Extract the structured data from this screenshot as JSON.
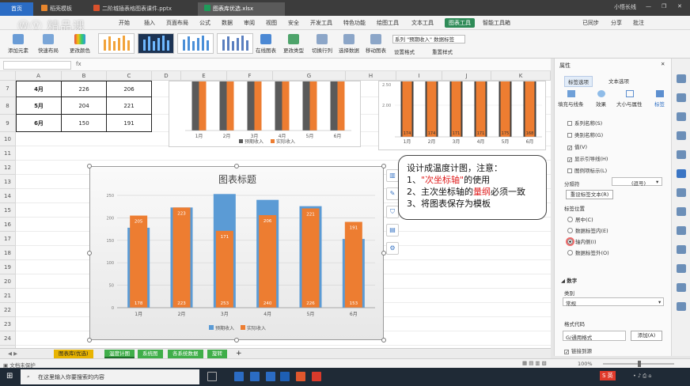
{
  "titlebar": {
    "home_tab": "首页",
    "tabs": [
      {
        "label": "稻壳模板",
        "color": "#e8862d"
      },
      {
        "label": "二阶城插表格图表课件.pptx",
        "color": "#d9512c"
      },
      {
        "label": "图表库优选.xlsx",
        "color": "#1e9b5a"
      }
    ],
    "user": "小悟长线",
    "win_controls": [
      "—",
      "❐",
      "✕"
    ]
  },
  "watermark": "ⓌⓋ 精品课",
  "menus": [
    "开始",
    "插入",
    "页面布局",
    "公式",
    "数据",
    "审阅",
    "视图",
    "安全",
    "开发工具",
    "特色功能",
    "绘图工具",
    "文本工具",
    "图表工具",
    "智能工具箱"
  ],
  "active_menu": "图表工具",
  "menu_right": [
    "已同步",
    "分享",
    "批注"
  ],
  "ribbon": {
    "left_buttons": [
      "添加元素",
      "快速布局",
      "更改颜色"
    ],
    "mid_buttons": [
      "在线图表",
      "更改类型",
      "切换行列",
      "选择数据",
      "移动图表"
    ],
    "series_dropdown": "系列 \"预期收入\" 数据标签",
    "format_buttons": [
      "设置格式",
      "重置样式"
    ]
  },
  "formula": {
    "fx": "fx"
  },
  "sheet": {
    "columns": [
      "A",
      "B",
      "C",
      "D",
      "E",
      "F",
      "G",
      "H",
      "I",
      "J",
      "K"
    ],
    "rows": [
      {
        "num": "7",
        "cells": [
          "4月",
          "226",
          "206"
        ]
      },
      {
        "num": "8",
        "cells": [
          "5月",
          "204",
          "221"
        ]
      },
      {
        "num": "9",
        "cells": [
          "6月",
          "150",
          "191"
        ]
      },
      {
        "num": "10",
        "cells": []
      },
      {
        "num": "11",
        "cells": []
      },
      {
        "num": "12",
        "cells": []
      },
      {
        "num": "13",
        "cells": []
      },
      {
        "num": "14",
        "cells": []
      },
      {
        "num": "15",
        "cells": []
      },
      {
        "num": "16",
        "cells": []
      },
      {
        "num": "17",
        "cells": []
      },
      {
        "num": "18",
        "cells": []
      },
      {
        "num": "19",
        "cells": []
      },
      {
        "num": "20",
        "cells": []
      },
      {
        "num": "21",
        "cells": []
      },
      {
        "num": "22",
        "cells": []
      },
      {
        "num": "23",
        "cells": []
      },
      {
        "num": "24",
        "cells": []
      },
      {
        "num": "25",
        "cells": []
      },
      {
        "num": "26",
        "cells": []
      }
    ]
  },
  "chart_data": [
    {
      "type": "bar",
      "title": "",
      "categories": [
        "1月",
        "2月",
        "3月",
        "4月",
        "5月",
        "6月"
      ],
      "series": [
        {
          "name": "预期收入",
          "color": "#5a5a5a"
        },
        {
          "name": "实际收入",
          "color": "#ed7d31"
        }
      ],
      "legend": "bottom"
    },
    {
      "type": "bar",
      "title": "",
      "categories": [
        "1月",
        "2月",
        "3月",
        "4月",
        "5月",
        "6月"
      ],
      "series": [
        {
          "name": "",
          "values": [
            174,
            174,
            171,
            171,
            175,
            168
          ],
          "color": "#ed7d31"
        }
      ],
      "ylim_labels": [
        "2.50",
        "2.00"
      ]
    },
    {
      "type": "bar",
      "title": "图表标题",
      "categories": [
        "1月",
        "2月",
        "3月",
        "4月",
        "5月",
        "6月"
      ],
      "ylim": [
        0,
        250
      ],
      "yticks": [
        0,
        50,
        100,
        150,
        200,
        250
      ],
      "series": [
        {
          "name": "预期收入",
          "values": [
            178,
            223,
            253,
            240,
            226,
            153
          ],
          "labels": [
            "178",
            "223",
            "253",
            "240",
            "226",
            "153"
          ],
          "color": "#5b9bd5"
        },
        {
          "name": "实际收入",
          "values": [
            205,
            223,
            171,
            206,
            221,
            191
          ],
          "labels": [
            "205",
            "223",
            "171",
            "206",
            "221",
            "191"
          ],
          "color": "#ed7d31"
        }
      ],
      "legend": "bottom"
    }
  ],
  "callout": {
    "line1": "设计成温度计图，注意：",
    "line2_pre": "1、",
    "line2_red": "\"次坐标轴\"",
    "line2_post": "的使用",
    "line3_pre": "2、主次坐标轴的",
    "line3_red": "量纲",
    "line3_post": "必须一致",
    "line4": "3、将图表保存为模板"
  },
  "panel": {
    "title": "属性",
    "tabs": [
      "标签选项",
      "文本选项"
    ],
    "icon_tabs": [
      "填充与线条",
      "效果",
      "大小与属性",
      "标签"
    ],
    "checks": [
      {
        "label": "系列名称(S)",
        "checked": false
      },
      {
        "label": "类别名称(G)",
        "checked": false
      },
      {
        "label": "值(V)",
        "checked": true
      },
      {
        "label": "显示引导线(H)",
        "checked": true
      },
      {
        "label": "图例项标示(L)",
        "checked": false
      }
    ],
    "separator_label": "分隔符",
    "separator_value": "(逗号)",
    "reset_button": "重设标签文本(R)",
    "position_label": "标签位置",
    "positions": [
      {
        "label": "居中(C)",
        "selected": false
      },
      {
        "label": "数据标签内(E)",
        "selected": false
      },
      {
        "label": "轴内侧(I)",
        "selected": true
      },
      {
        "label": "数据标签外(O)",
        "selected": false
      }
    ],
    "number_section": "数字",
    "category_label": "类别",
    "category_value": "常规",
    "format_code_label": "格式代码",
    "format_code_value": "G/通用格式",
    "add_button": "添加(A)",
    "link_source": "链接到源"
  },
  "sheet_tabs": [
    {
      "label": "图表库(优选)",
      "color": "#e8b400"
    },
    {
      "label": "温度计图",
      "color": "#3fae49",
      "active": true
    },
    {
      "label": "系统图",
      "color": "#3fae49"
    },
    {
      "label": "各系统数据",
      "color": "#3fae49"
    },
    {
      "label": "旋转",
      "color": "#3fae49"
    }
  ],
  "status": {
    "left": "文档未保护",
    "zoom": "100%"
  },
  "taskbar": {
    "search_placeholder": "在这里输入你要搜索的内容",
    "time": "",
    "ime": "英"
  }
}
